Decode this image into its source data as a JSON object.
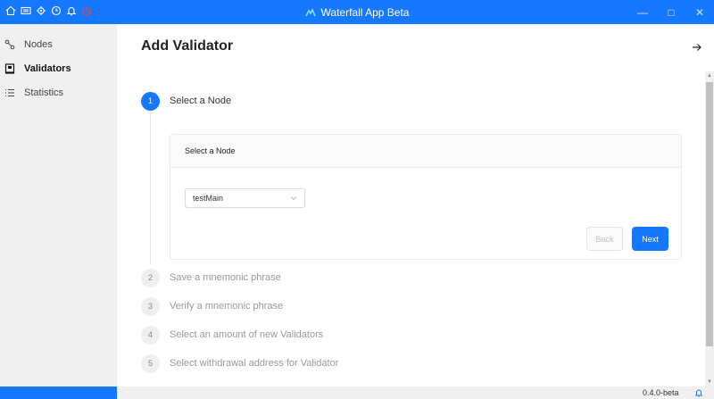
{
  "window": {
    "title": "Waterfall App Beta",
    "minimize_icon": "minimize-icon",
    "maximize_icon": "maximize-icon",
    "close_icon": "close-icon"
  },
  "toolbar_icons": [
    "home-icon",
    "keyboard-icon",
    "gear-icon",
    "clock-icon",
    "bell-icon",
    "power-icon"
  ],
  "sidebar": {
    "items": [
      {
        "label": "Nodes",
        "icon": "nodes-icon"
      },
      {
        "label": "Validators",
        "icon": "validator-icon",
        "active": true
      },
      {
        "label": "Statistics",
        "icon": "list-icon"
      }
    ]
  },
  "main": {
    "title": "Add Validator",
    "steps": [
      {
        "num": "1",
        "label": "Select a Node",
        "state": "active"
      },
      {
        "num": "2",
        "label": "Save a mnemonic phrase",
        "state": "idle"
      },
      {
        "num": "3",
        "label": "Verify a mnemonic phrase",
        "state": "idle"
      },
      {
        "num": "4",
        "label": "Select an amount of new Validators",
        "state": "idle"
      },
      {
        "num": "5",
        "label": "Select withdrawal address for Validator",
        "state": "idle"
      }
    ],
    "card": {
      "header": "Select a Node",
      "select_value": "testMain",
      "back_label": "Back",
      "next_label": "Next"
    }
  },
  "status": {
    "version": "0.4.0-beta"
  },
  "colors": {
    "accent": "#1677ff",
    "sidebar_bg": "#f0f0f0"
  }
}
